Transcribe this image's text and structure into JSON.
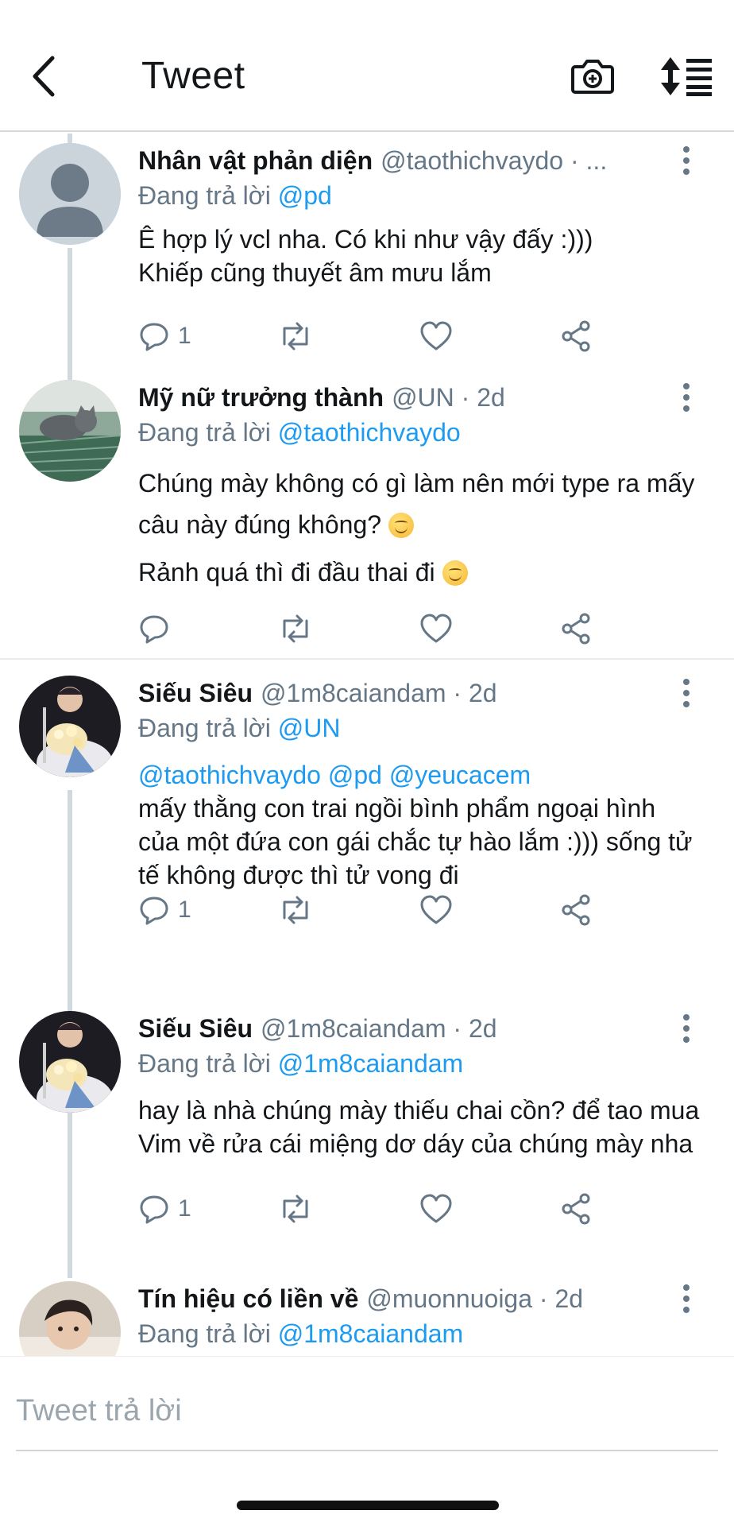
{
  "header": {
    "title": "Tweet",
    "back_icon": "chevron-left-icon",
    "camera_icon": "camera-icon",
    "sort_icon": "sort-icon"
  },
  "tweets": [
    {
      "name": "Nhân vật phản diện",
      "handle": "@taothichvaydo · ...",
      "reply_prefix": "Đang trả lời",
      "reply_to": "@pd",
      "paragraphs": [
        "Ê hợp lý vcl nha. Có khi như vậy đấy :)))",
        "Khiếp cũng thuyết âm mưu lắm"
      ],
      "reply_count": "1"
    },
    {
      "name": "Mỹ nữ trưởng thành",
      "handle": "@UN · 2d",
      "reply_prefix": "Đang trả lời",
      "reply_to": "@taothichvaydo",
      "paragraphs": [
        "Chúng mày không có gì làm nên mới type ra mấy câu này đúng không?",
        "Rảnh quá thì đi đầu thai đi"
      ],
      "reply_count": ""
    },
    {
      "name": "Siếu Siêu",
      "handle": "@1m8caiandam · 2d",
      "reply_prefix": "Đang trả lời",
      "reply_to": "@UN",
      "mentions": "@taothichvaydo @pd @yeucacem",
      "paragraphs": [
        "mấy thằng con trai ngồi bình phẩm ngoại hình của một đứa con gái chắc tự hào lắm :))) sống tử tế không được thì tử vong đi"
      ],
      "reply_count": "1"
    },
    {
      "name": "Siếu Siêu",
      "handle": "@1m8caiandam · 2d",
      "reply_prefix": "Đang trả lời",
      "reply_to": "@1m8caiandam",
      "paragraphs": [
        "hay là nhà chúng mày thiếu chai cồn? để tao mua Vim về rửa cái miệng dơ dáy của chúng mày nha"
      ],
      "reply_count": "1"
    },
    {
      "name": "Tín hiệu có liền về",
      "handle": "@muonnuoiga · 2d",
      "reply_prefix": "Đang trả lời",
      "reply_to": "@1m8caiandam"
    }
  ],
  "compose": {
    "placeholder": "Tweet trả lời"
  },
  "colors": {
    "link": "#1d9bf0",
    "muted": "#657786",
    "text": "#14171a"
  }
}
